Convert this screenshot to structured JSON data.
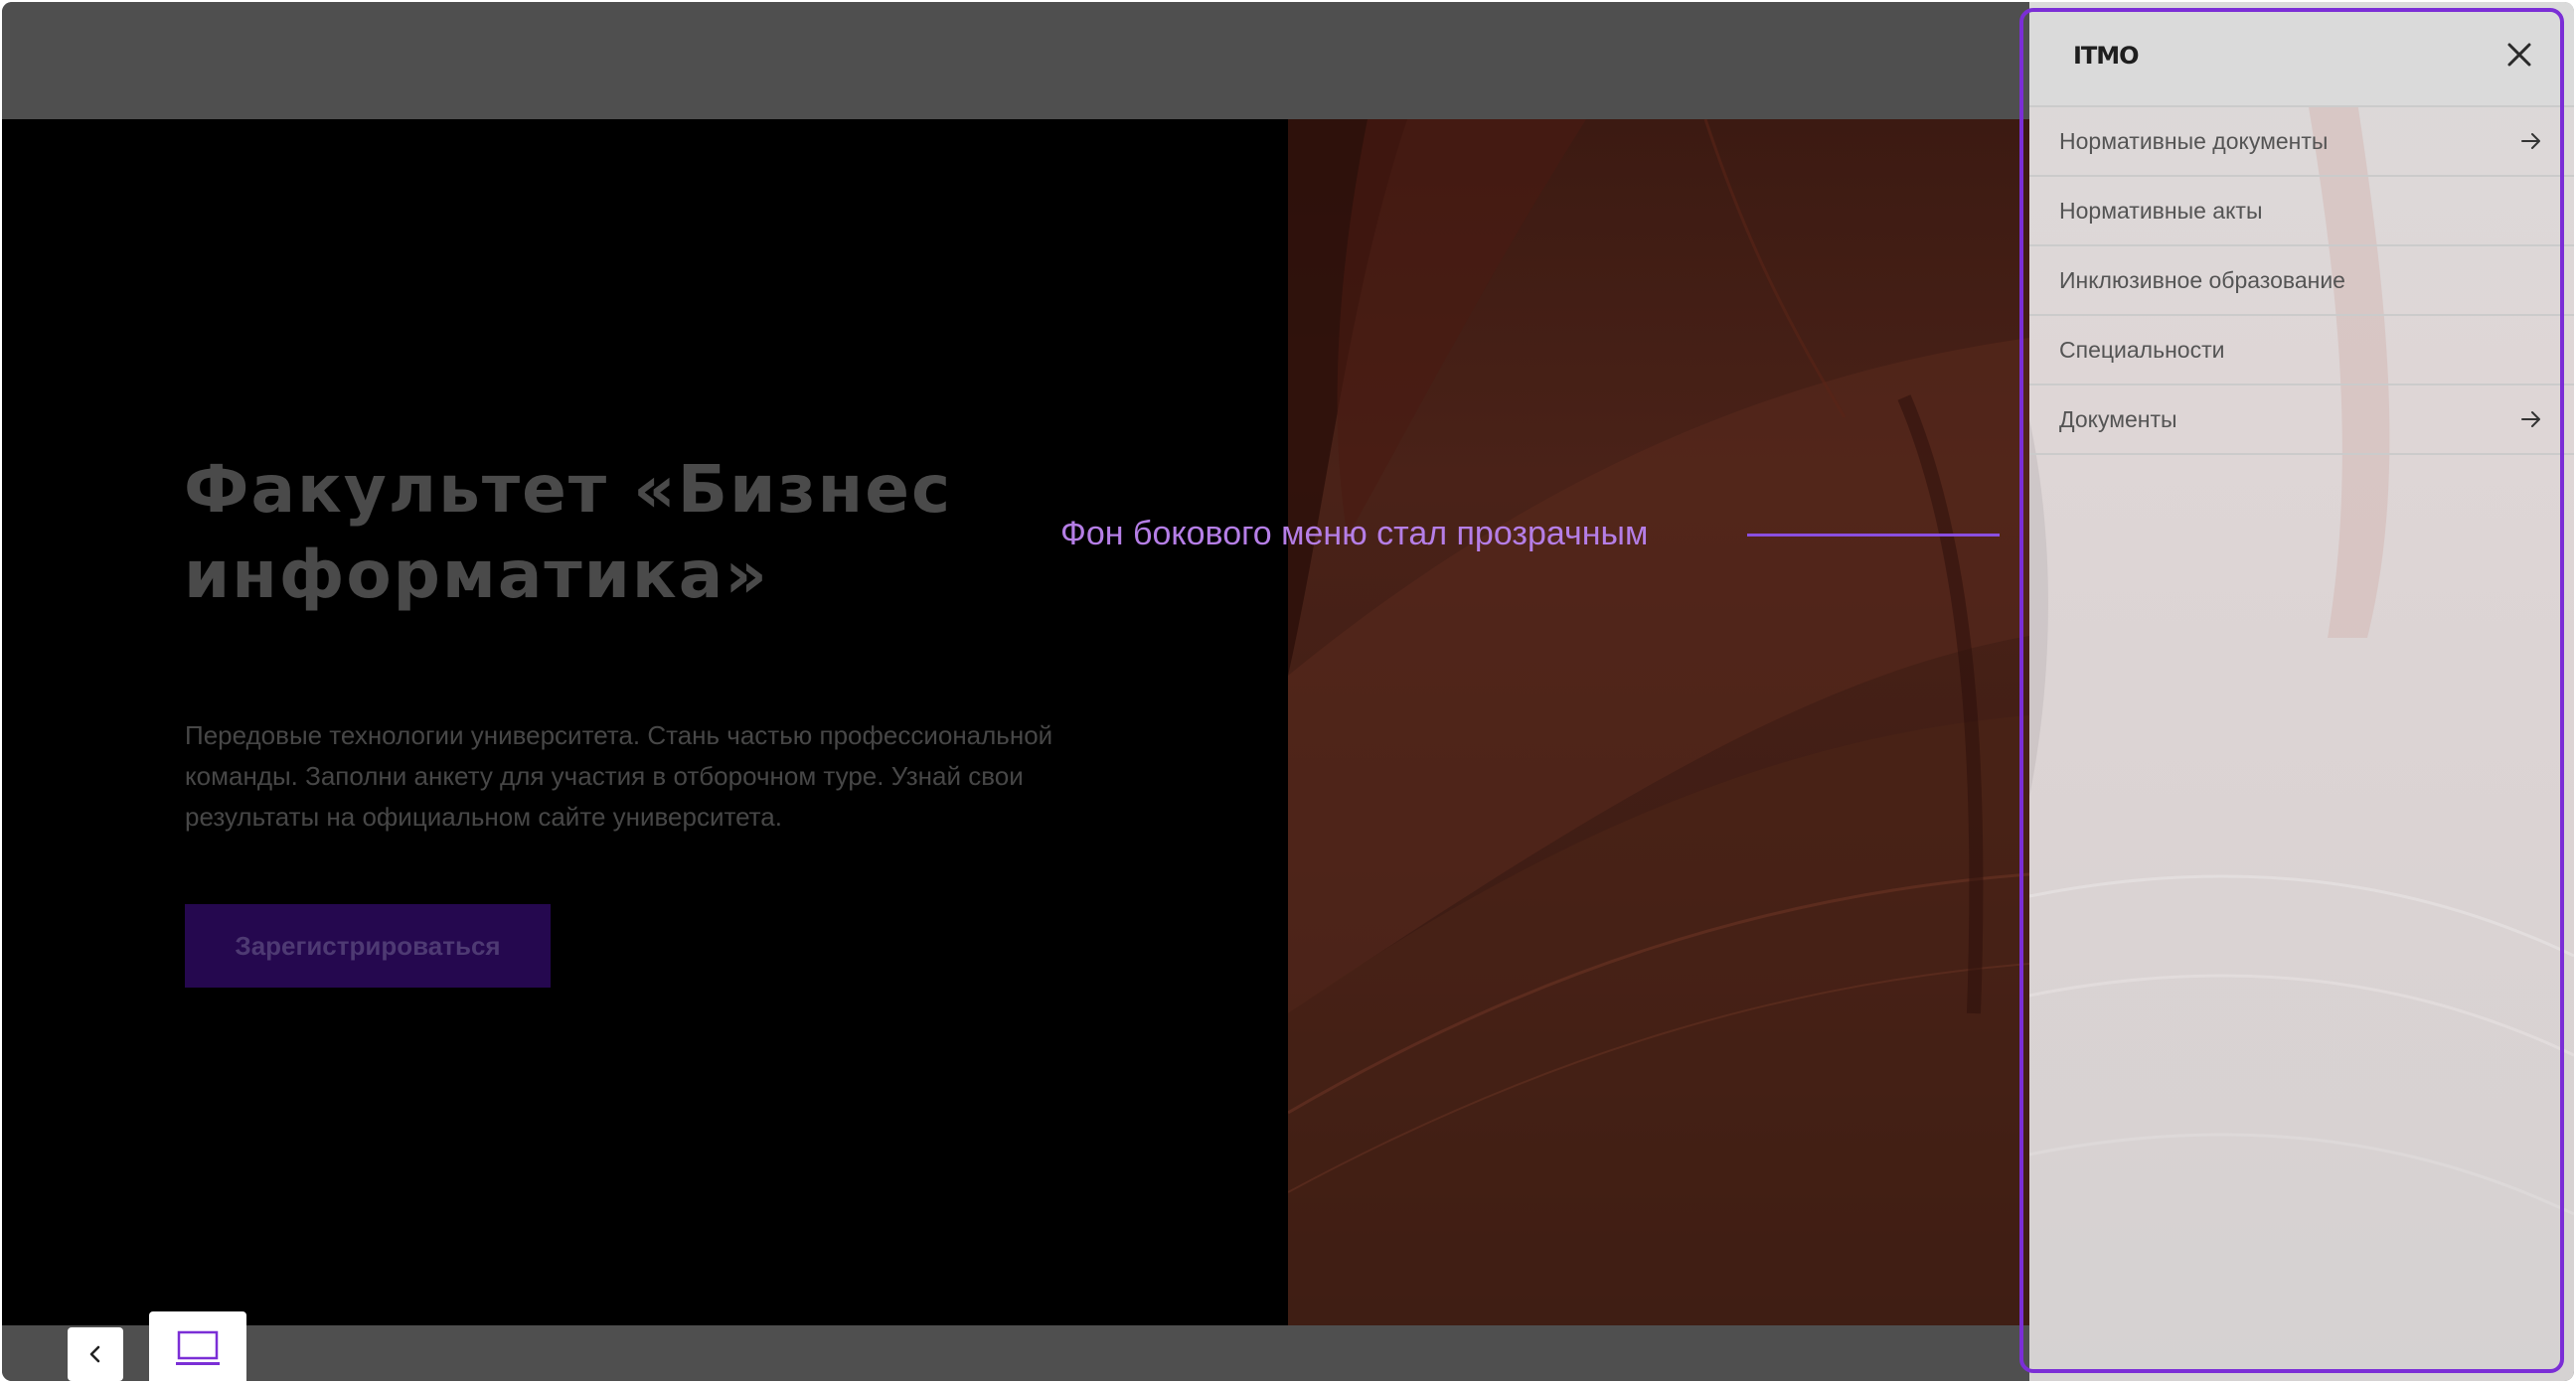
{
  "hero": {
    "title_line1": "Факультет «Бизнес",
    "title_line2": "информатика»",
    "description_lines": [
      "Передовые технологии университета. Стань частью профессиональной",
      "команды. Заполни анкету для участия в отборочном туре. Узнай свои",
      "результаты на официальном сайте университета."
    ],
    "register_label": "Зарегистрироваться"
  },
  "annotation": {
    "text": "Фон бокового меню стал прозрачным",
    "color": "#b57ee6",
    "highlight_color": "#7b2ed6"
  },
  "sidebar": {
    "logo_text": "ITMO",
    "close_icon": "close-icon",
    "items": [
      {
        "label": "Нормативные документы",
        "has_arrow": true
      },
      {
        "label": "Нормативные акты",
        "has_arrow": false
      },
      {
        "label": "Инклюзивное образование",
        "has_arrow": false
      },
      {
        "label": "Специальности",
        "has_arrow": false
      },
      {
        "label": "Документы",
        "has_arrow": true
      }
    ]
  },
  "footer": {
    "back_icon": "chevron-left-icon",
    "device_icon": "laptop-icon"
  },
  "colors": {
    "accent": "#8a4fe0",
    "button_bg": "#25084f"
  }
}
